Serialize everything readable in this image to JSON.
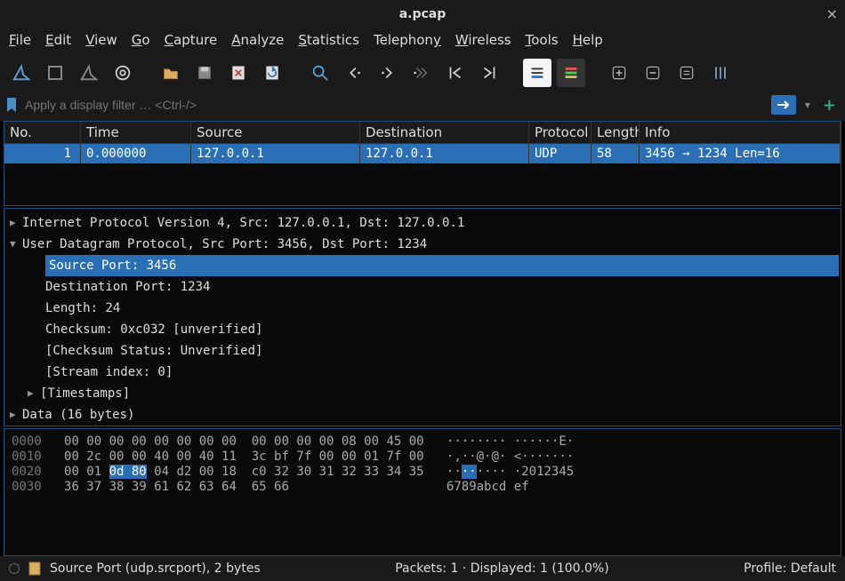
{
  "window": {
    "title": "a.pcap",
    "close": "×"
  },
  "menu": {
    "file": "File",
    "edit": "Edit",
    "view": "View",
    "go": "Go",
    "capture": "Capture",
    "analyze": "Analyze",
    "statistics": "Statistics",
    "telephony": "Telephony",
    "wireless": "Wireless",
    "tools": "Tools",
    "help": "Help"
  },
  "filter": {
    "placeholder": "Apply a display filter … <Ctrl-/>"
  },
  "packet_list": {
    "headers": {
      "no": "No.",
      "time": "Time",
      "source": "Source",
      "destination": "Destination",
      "protocol": "Protocol",
      "length": "Length",
      "info": "Info"
    },
    "rows": [
      {
        "no": "1",
        "time": "0.000000",
        "source": "127.0.0.1",
        "destination": "127.0.0.1",
        "protocol": "UDP",
        "length": "58",
        "info": "3456 → 1234 Len=16"
      }
    ]
  },
  "details": {
    "ipv4": "Internet Protocol Version 4, Src: 127.0.0.1, Dst: 127.0.0.1",
    "udp": "User Datagram Protocol, Src Port: 3456, Dst Port: 1234",
    "src_port": "Source Port: 3456",
    "dst_port": "Destination Port: 1234",
    "length": "Length: 24",
    "checksum": "Checksum: 0xc032 [unverified]",
    "checksum_status": "[Checksum Status: Unverified]",
    "stream": "[Stream index: 0]",
    "timestamps": "[Timestamps]",
    "data": "Data (16 bytes)"
  },
  "hex": {
    "l0_off": "0000",
    "l0_h": "00 00 00 00 00 00 00 00  00 00 00 00 08 00 45 00",
    "l0_a": "········ ······E·",
    "l1_off": "0010",
    "l1_h": "00 2c 00 00 40 00 40 11  3c bf 7f 00 00 01 7f 00",
    "l1_a": "·,··@·@· <·······",
    "l2_off": "0020",
    "l2_pre": "00 01 ",
    "l2_sel": "0d 80",
    "l2_post": " 04 d2 00 18  c0 32 30 31 32 33 34 35",
    "l2_a_pre": "··",
    "l2_a_sel": "··",
    "l2_a_post": "···· ·2012345",
    "l3_off": "0030",
    "l3_h": "36 37 38 39 61 62 63 64  65 66",
    "l3_a": "6789abcd ef"
  },
  "status": {
    "field": "Source Port (udp.srcport), 2 bytes",
    "packets": "Packets: 1 · Displayed: 1 (100.0%)",
    "profile": "Profile: Default"
  }
}
